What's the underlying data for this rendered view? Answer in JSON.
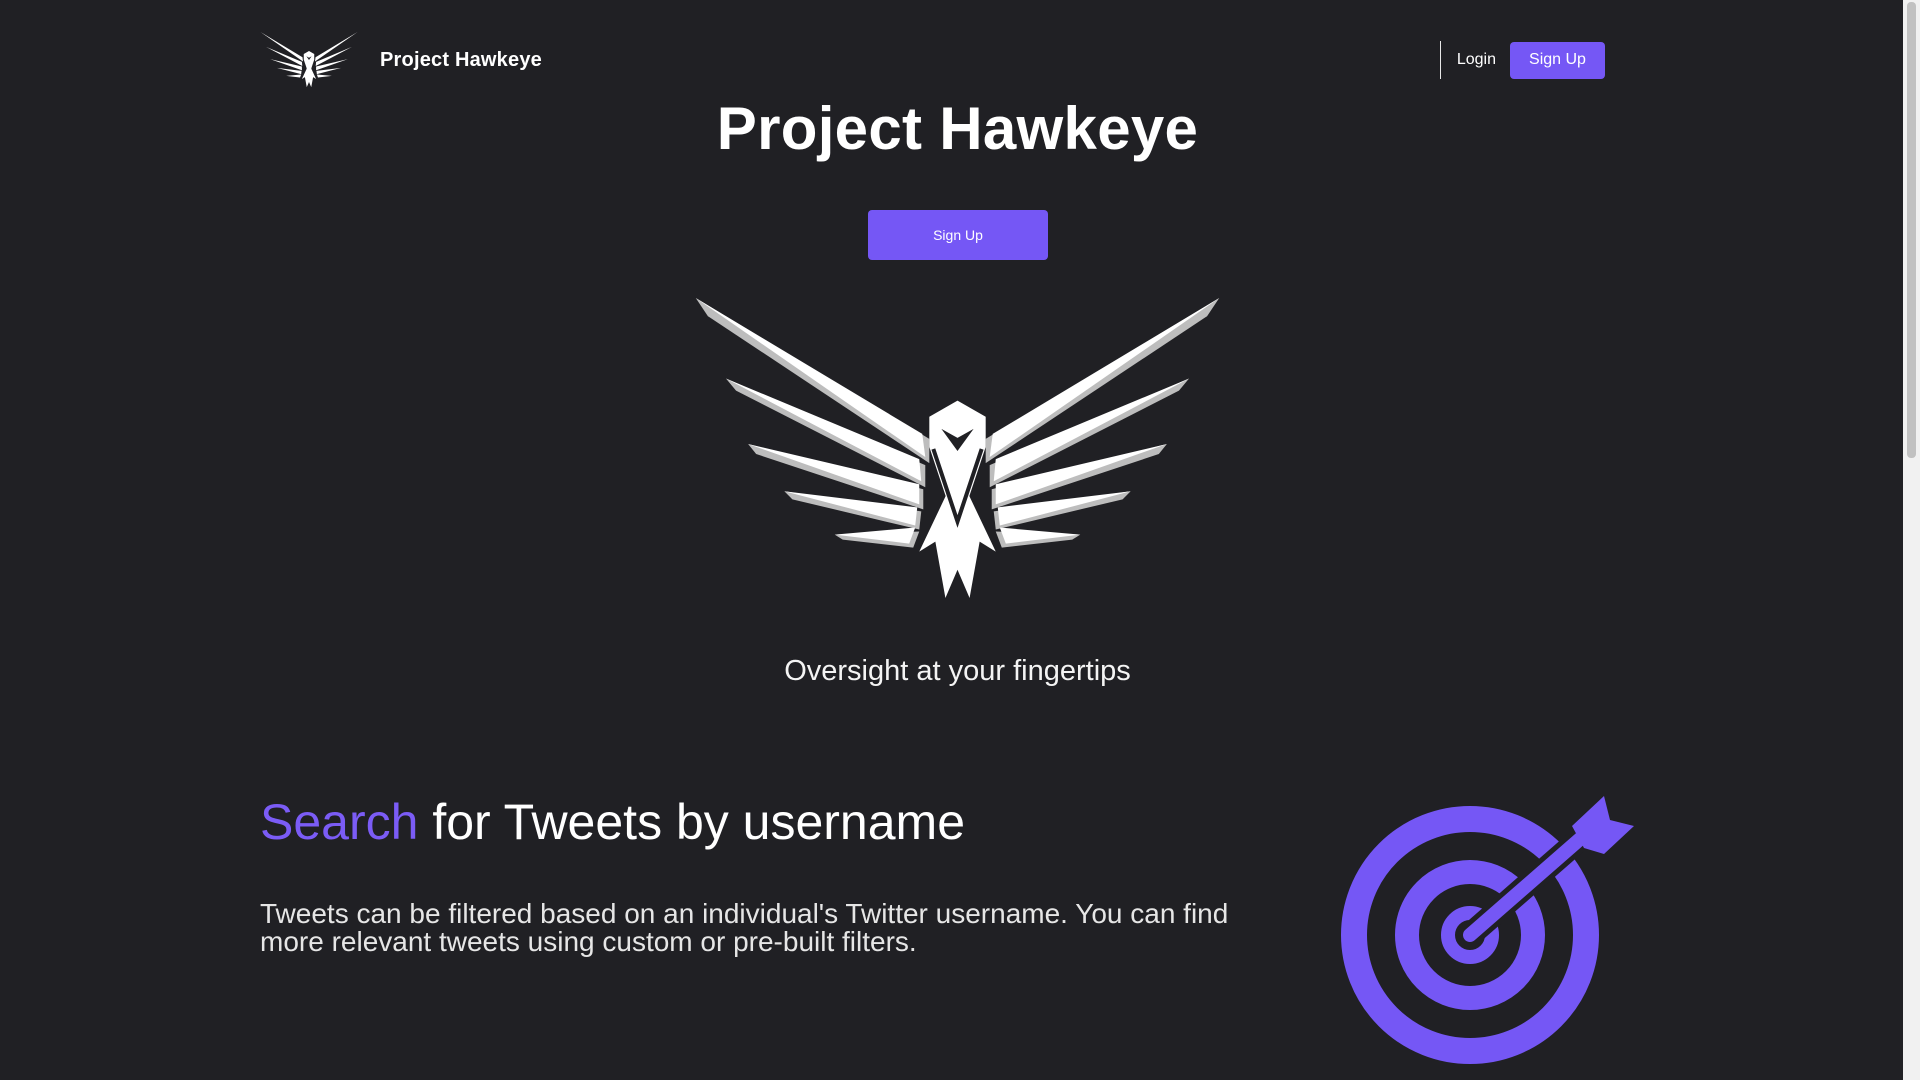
{
  "header": {
    "brand_name": "Project Hawkeye",
    "brand_logo_icon": "hawk-emblem-icon",
    "login_label": "Login",
    "signup_label": "Sign Up"
  },
  "hero": {
    "title": "Project Hawkeye",
    "signup_label": "Sign Up",
    "logo_icon": "hawk-emblem-icon",
    "tagline": "Oversight at your fingertips"
  },
  "feature": {
    "heading_accent": "Search",
    "heading_rest": " for Tweets by username",
    "description": "Tweets can be filtered based on an individual's Twitter username. You can find more relevant tweets using custom or pre-built filters.",
    "icon": "target-arrow-icon"
  },
  "colors": {
    "background": "#202024",
    "accent": "#7557f5",
    "text": "#ffffff"
  }
}
